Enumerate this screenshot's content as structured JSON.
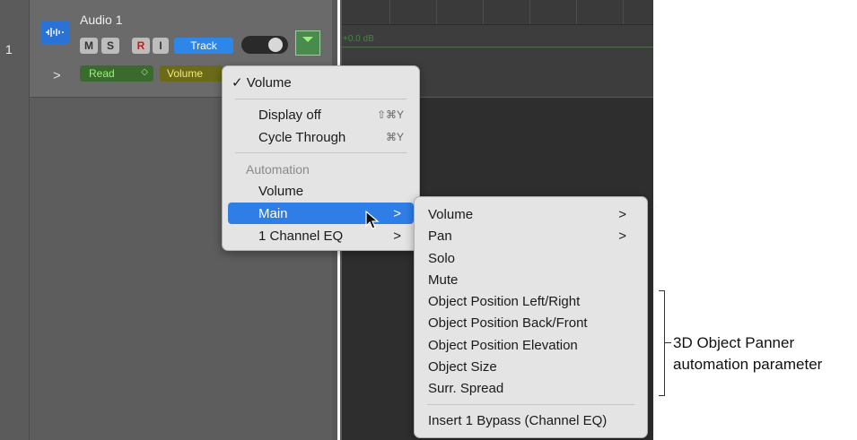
{
  "track": {
    "number": "1",
    "name": "Audio 1",
    "buttons": {
      "mute": "M",
      "solo": "S",
      "record": "R",
      "input": "I",
      "track": "Track"
    },
    "expand_glyph": ">",
    "automation_mode": "Read",
    "automation_mode_arrows": "◇",
    "automation_param": "Volume"
  },
  "timeline": {
    "level_readout": "+0.0 dB"
  },
  "menu1": {
    "checked_item": "✓ Volume",
    "display_off": "Display off",
    "display_off_shortcut": "⇧⌘Y",
    "cycle_through": "Cycle Through",
    "cycle_through_shortcut": "⌘Y",
    "section_header": "Automation",
    "volume": "Volume",
    "main": "Main",
    "channel_eq": "1 Channel EQ",
    "submenu_arrow": ">"
  },
  "menu2": {
    "items": [
      "Volume",
      "Pan",
      "Solo",
      "Mute",
      "Object Position Left/Right",
      "Object Position Back/Front",
      "Object Position Elevation",
      "Object Size",
      "Surr. Spread"
    ],
    "footer": "Insert 1 Bypass (Channel EQ)",
    "submenu_arrow": ">"
  },
  "callout": {
    "line1": "3D Object Panner",
    "line2": "automation parameter"
  },
  "colors": {
    "accent": "#2f7de6",
    "read_mode": "#9cf07c",
    "volume_param": "#ecec7a",
    "record": "#c0201a"
  }
}
